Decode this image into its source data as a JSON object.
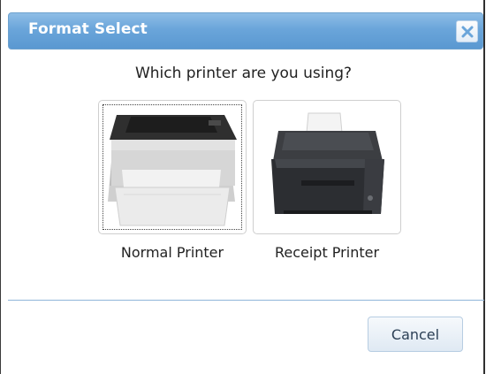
{
  "dialog": {
    "title": "Format Select",
    "question": "Which printer are you using?",
    "close_icon": "close-icon",
    "options": [
      {
        "label": "Normal Printer",
        "icon": "laser-printer-icon",
        "focused": true
      },
      {
        "label": "Receipt Printer",
        "icon": "receipt-printer-icon",
        "focused": false
      }
    ],
    "cancel_label": "Cancel"
  },
  "colors": {
    "titlebar": "#6aa5da",
    "divider": "#8fb6d9",
    "button_text": "#2b3f55"
  }
}
